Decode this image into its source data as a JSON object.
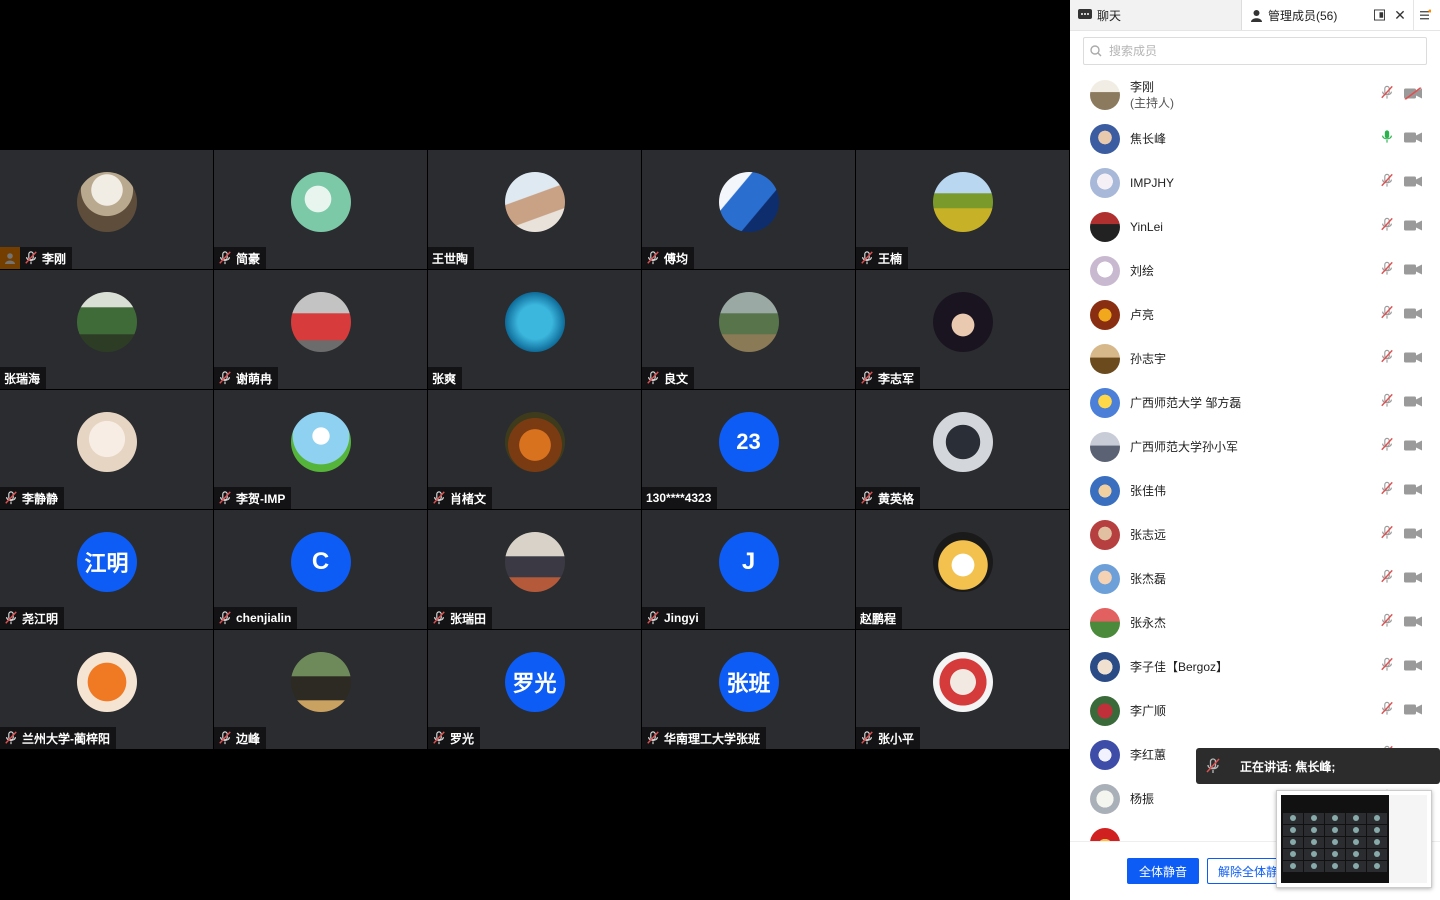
{
  "colors": {
    "accent": "#0c5cf5",
    "tile_bg": "#2b2c2f",
    "host_badge": "#ff8a00",
    "mic_muted": "#e05050",
    "mic_active": "#2bb24c"
  },
  "tiles": [
    {
      "name": "李刚",
      "muted": true,
      "host": true,
      "avatar": "photo-garden"
    },
    {
      "name": "简豪",
      "muted": true,
      "avatar": "photo-silhouette"
    },
    {
      "name": "王世陶",
      "muted": false,
      "avatar": "photo-family"
    },
    {
      "name": "傅均",
      "muted": true,
      "avatar": "photo-blue"
    },
    {
      "name": "王楠",
      "muted": true,
      "avatar": "photo-field"
    },
    {
      "name": "张瑞海",
      "muted": false,
      "avatar": "photo-forest"
    },
    {
      "name": "谢萌冉",
      "muted": true,
      "avatar": "photo-couple"
    },
    {
      "name": "张爽",
      "muted": false,
      "avatar": "photo-swim"
    },
    {
      "name": "良文",
      "muted": true,
      "avatar": "photo-mountain"
    },
    {
      "name": "李志军",
      "muted": true,
      "avatar": "photo-man"
    },
    {
      "name": "李静静",
      "muted": true,
      "avatar": "photo-baby"
    },
    {
      "name": "李贺-IMP",
      "muted": true,
      "avatar": "photo-dandelion"
    },
    {
      "name": "肖楮文",
      "muted": true,
      "avatar": "photo-food"
    },
    {
      "name": "130****4323",
      "muted": false,
      "avatar_text": "23"
    },
    {
      "name": "黄英格",
      "muted": true,
      "avatar": "photo-hood"
    },
    {
      "name": "尧江明",
      "muted": true,
      "avatar_text": "江明"
    },
    {
      "name": "chenjialin",
      "muted": true,
      "avatar_text": "C"
    },
    {
      "name": "张瑞田",
      "muted": true,
      "avatar": "photo-kid"
    },
    {
      "name": "Jingyi",
      "muted": true,
      "avatar_text": "J"
    },
    {
      "name": "赵鹏程",
      "muted": false,
      "avatar": "photo-cartoon"
    },
    {
      "name": "兰州大学-蔺梓阳",
      "muted": true,
      "avatar": "photo-fox"
    },
    {
      "name": "边峰",
      "muted": true,
      "avatar": "photo-tree"
    },
    {
      "name": "罗光",
      "muted": true,
      "avatar_text": "罗光"
    },
    {
      "name": "华南理工大学张班",
      "muted": true,
      "avatar_text": "张班"
    },
    {
      "name": "张小平",
      "muted": true,
      "avatar": "photo-flowers"
    }
  ],
  "sidebar": {
    "tab_chat": "聊天",
    "tab_members": "管理成员(56)",
    "search_placeholder": "搜索成员",
    "members": [
      {
        "name": "李刚",
        "sub": "(主持人)",
        "mic": "muted",
        "cam": "off"
      },
      {
        "name": "焦长峰",
        "mic": "active",
        "cam": "on"
      },
      {
        "name": "IMPJHY",
        "mic": "muted",
        "cam": "on"
      },
      {
        "name": "YinLei",
        "mic": "muted",
        "cam": "on"
      },
      {
        "name": "刘绘",
        "mic": "muted",
        "cam": "on"
      },
      {
        "name": "卢亮",
        "mic": "muted",
        "cam": "on"
      },
      {
        "name": "孙志宇",
        "mic": "muted",
        "cam": "on"
      },
      {
        "name": "广西师范大学 邹方磊",
        "mic": "muted",
        "cam": "on"
      },
      {
        "name": "广西师范大学孙小军",
        "mic": "muted",
        "cam": "on"
      },
      {
        "name": "张佳伟",
        "mic": "muted",
        "cam": "on"
      },
      {
        "name": "张志远",
        "mic": "muted",
        "cam": "on"
      },
      {
        "name": "张杰磊",
        "mic": "muted",
        "cam": "on"
      },
      {
        "name": "张永杰",
        "mic": "muted",
        "cam": "on"
      },
      {
        "name": "李子佳【Bergoz】",
        "mic": "muted",
        "cam": "on"
      },
      {
        "name": "李广顺",
        "mic": "muted",
        "cam": "on"
      },
      {
        "name": "李红蕙",
        "mic": "muted",
        "cam": "on"
      },
      {
        "name": "杨振",
        "mic": "muted",
        "cam": "on"
      },
      {
        "name": "",
        "mic": "muted",
        "cam": "on"
      }
    ],
    "mute_all": "全体静音",
    "unmute_all": "解除全体静音"
  },
  "speaking": {
    "label": "正在讲话: 焦长峰;"
  }
}
